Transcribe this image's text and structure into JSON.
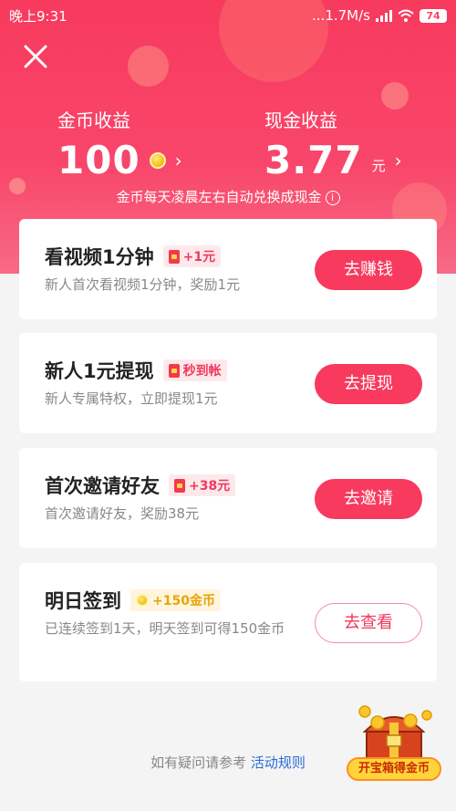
{
  "status": {
    "time": "晚上9:31",
    "network": "...1.7M/s",
    "battery": "74"
  },
  "earnings": {
    "coin_label": "金币收益",
    "coin_value": "100",
    "cash_label": "现金收益",
    "cash_value": "3.77",
    "cash_unit": "元",
    "note": "金币每天凌晨左右自动兑换成现金"
  },
  "tasks": [
    {
      "title": "看视频1分钟",
      "badge": "+1元",
      "desc": "新人首次看视频1分钟，奖励1元",
      "button": "去赚钱"
    },
    {
      "title": "新人1元提现",
      "badge": "秒到帐",
      "desc": "新人专属特权，立即提现1元",
      "button": "去提现"
    },
    {
      "title": "首次邀请好友",
      "badge": "+38元",
      "desc": "首次邀请好友，奖励38元",
      "button": "去邀请"
    },
    {
      "title": "明日签到",
      "badge": "+150金币",
      "desc": "已连续签到1天，明天签到可得150金币",
      "button": "去查看"
    }
  ],
  "footer": {
    "text": "如有疑问请参考",
    "link": "活动规则"
  },
  "chest": {
    "label": "开宝箱得金币"
  },
  "colors": {
    "accent": "#f73a5e",
    "gold": "#f8c51c"
  }
}
